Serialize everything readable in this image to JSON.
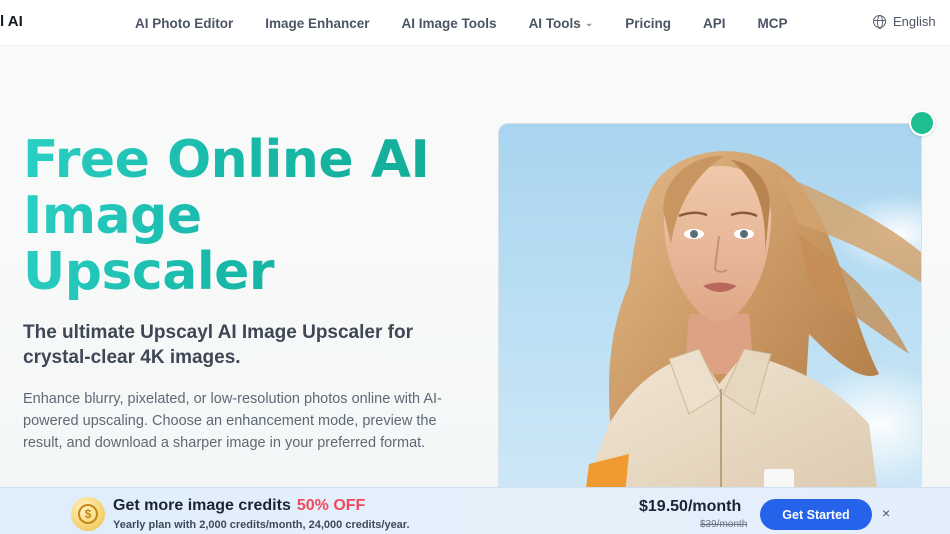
{
  "brand": {
    "logo_text": "l AI"
  },
  "nav": {
    "items": [
      {
        "label": "AI Photo Editor"
      },
      {
        "label": "Image Enhancer"
      },
      {
        "label": "AI Image Tools"
      },
      {
        "label": "AI Tools"
      },
      {
        "label": "Pricing"
      },
      {
        "label": "API"
      },
      {
        "label": "MCP"
      }
    ],
    "language": "English"
  },
  "hero": {
    "title_lines": [
      "Free Online AI",
      "Image",
      "Upscaler"
    ],
    "subtitle": "The ultimate Upscayl AI Image Upscaler for crystal-clear 4K images.",
    "description": "Enhance blurry, pixelated, or low-resolution photos online with AI-powered upscaling. Choose an enhancement mode, preview the result, and download a sharper image in your preferred format."
  },
  "promo": {
    "title": "Get more image credits",
    "discount": "50% OFF",
    "detail": "Yearly plan with 2,000 credits/month, 24,000 credits/year.",
    "price": "$19.50/month",
    "old_price": "$39/month",
    "cta_label": "Get Started",
    "close_symbol": "×",
    "coin_symbol": "$"
  },
  "colors": {
    "accent_teal": "#18b8a8",
    "cta_blue": "#2563eb",
    "discount_red": "#ef4a5c",
    "status_dot": "#1fbf94"
  }
}
